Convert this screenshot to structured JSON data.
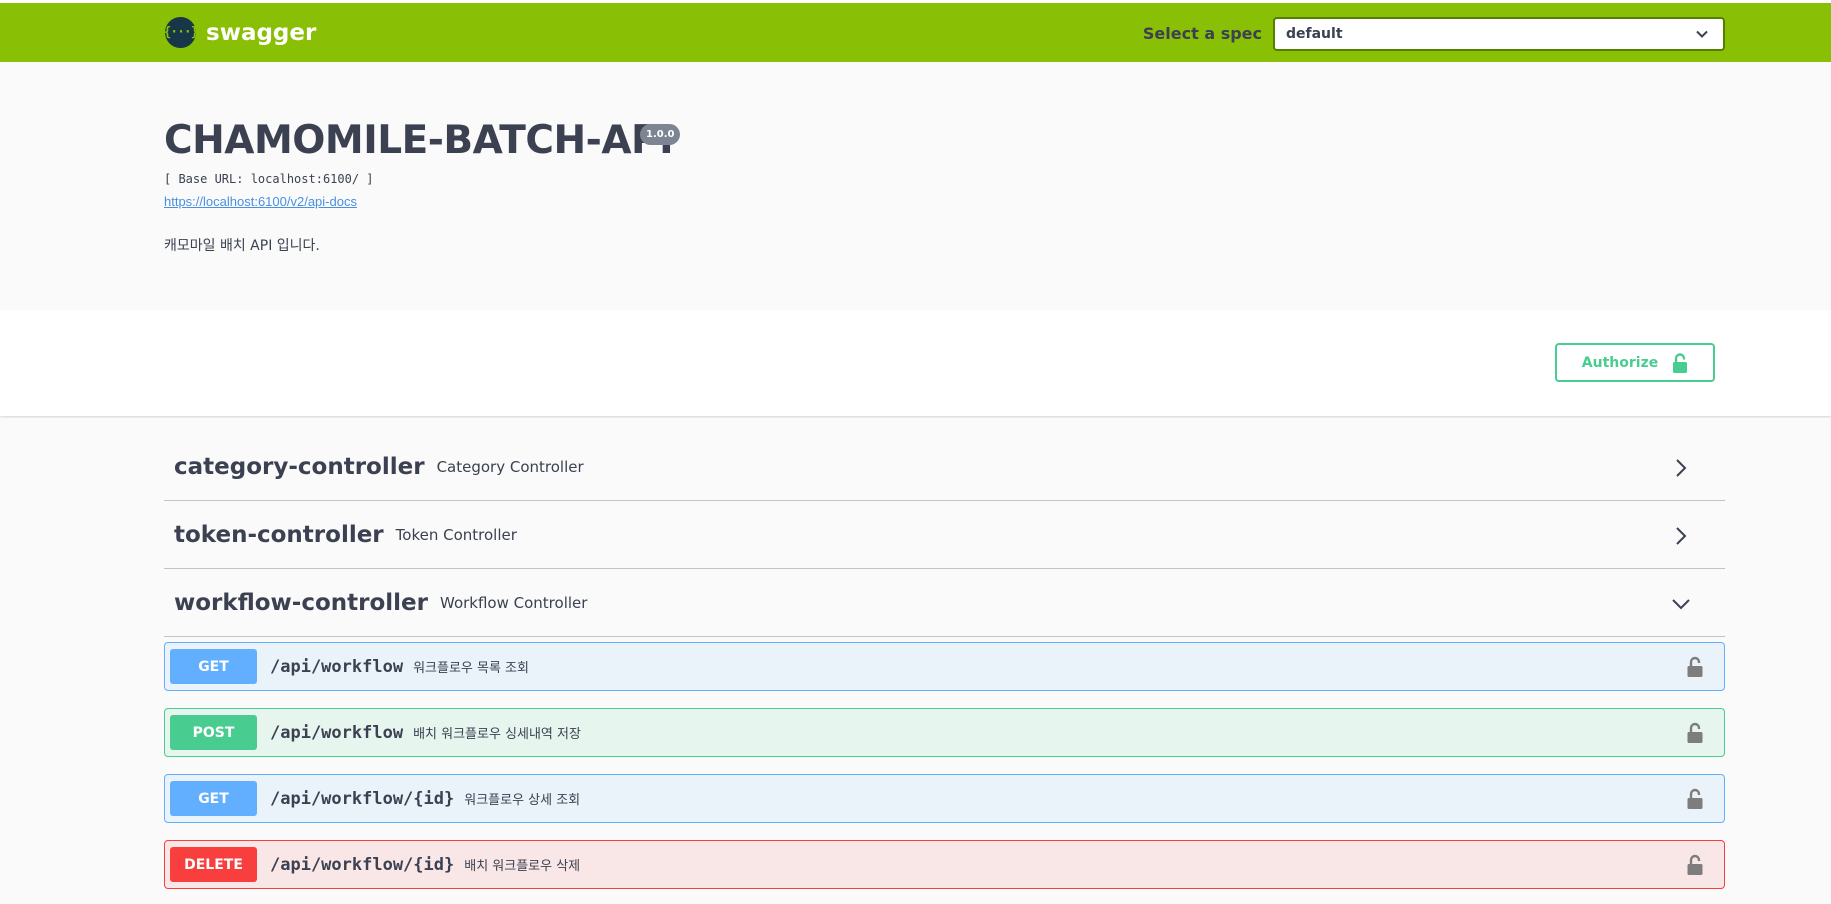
{
  "topbar": {
    "brand": "swagger",
    "logo_glyph": "{···}",
    "spec_label": "Select a spec",
    "spec_value": "default"
  },
  "info": {
    "title": "CHAMOMILE-BATCH-API",
    "version": "1.0.0",
    "base_url": "[ Base URL: localhost:6100/ ]",
    "docs_link": "https://localhost:6100/v2/api-docs",
    "description": "캐모마일 배치 API 입니다."
  },
  "auth": {
    "authorize_label": "Authorize"
  },
  "tags": [
    {
      "name": "category-controller",
      "description": "Category Controller",
      "expanded": false
    },
    {
      "name": "token-controller",
      "description": "Token Controller",
      "expanded": false
    },
    {
      "name": "workflow-controller",
      "description": "Workflow Controller",
      "expanded": true
    }
  ],
  "operations": [
    {
      "method": "GET",
      "path": "/api/workflow",
      "summary": "워크플로우 목록 조회"
    },
    {
      "method": "POST",
      "path": "/api/workflow",
      "summary": "배치 워크플로우 싱세내역 저장"
    },
    {
      "method": "GET",
      "path": "/api/workflow/{id}",
      "summary": "워크플로우 상세 조회"
    },
    {
      "method": "DELETE",
      "path": "/api/workflow/{id}",
      "summary": "배치 워크플로우 삭제"
    }
  ],
  "colors": {
    "topbar": "#89bf04",
    "get": "#61affe",
    "post": "#49cc90",
    "delete": "#f93e3e",
    "authorize": "#49cc90"
  }
}
